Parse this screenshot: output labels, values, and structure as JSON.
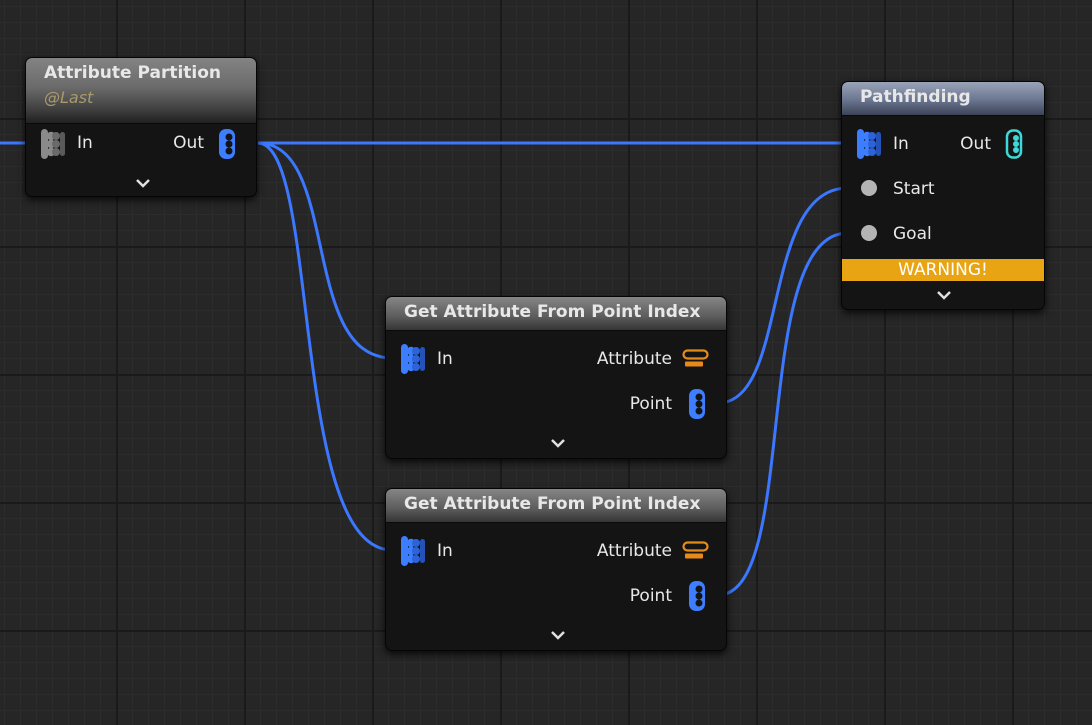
{
  "nodes": {
    "attribute_partition": {
      "title": "Attribute Partition",
      "subtitle": "@Last",
      "input_label": "In",
      "output_label": "Out"
    },
    "get_attribute_1": {
      "title": "Get Attribute From Point Index",
      "input_label": "In",
      "attribute_label": "Attribute",
      "point_label": "Point"
    },
    "get_attribute_2": {
      "title": "Get Attribute From Point Index",
      "input_label": "In",
      "attribute_label": "Attribute",
      "point_label": "Point"
    },
    "pathfinding": {
      "title": "Pathfinding",
      "input_label": "In",
      "output_label": "Out",
      "start_label": "Start",
      "goal_label": "Goal",
      "warning": "WARNING!"
    }
  },
  "icons": {
    "points_pin": "points-stack-icon",
    "attribute_pin": "attribute-set-icon",
    "point_pin": "point-data-icon",
    "param_pin": "param-dot-icon",
    "expand": "chevron-down-icon"
  },
  "colors": {
    "wire": "#3b78ff",
    "pin_blue": "#3d7dff",
    "pin_grey": "#8a8a8a",
    "pin_cyan": "#3fd8d8",
    "pin_orange": "#e88a1a",
    "warning_bg": "#e8a413",
    "path_header": "#6a7590"
  }
}
